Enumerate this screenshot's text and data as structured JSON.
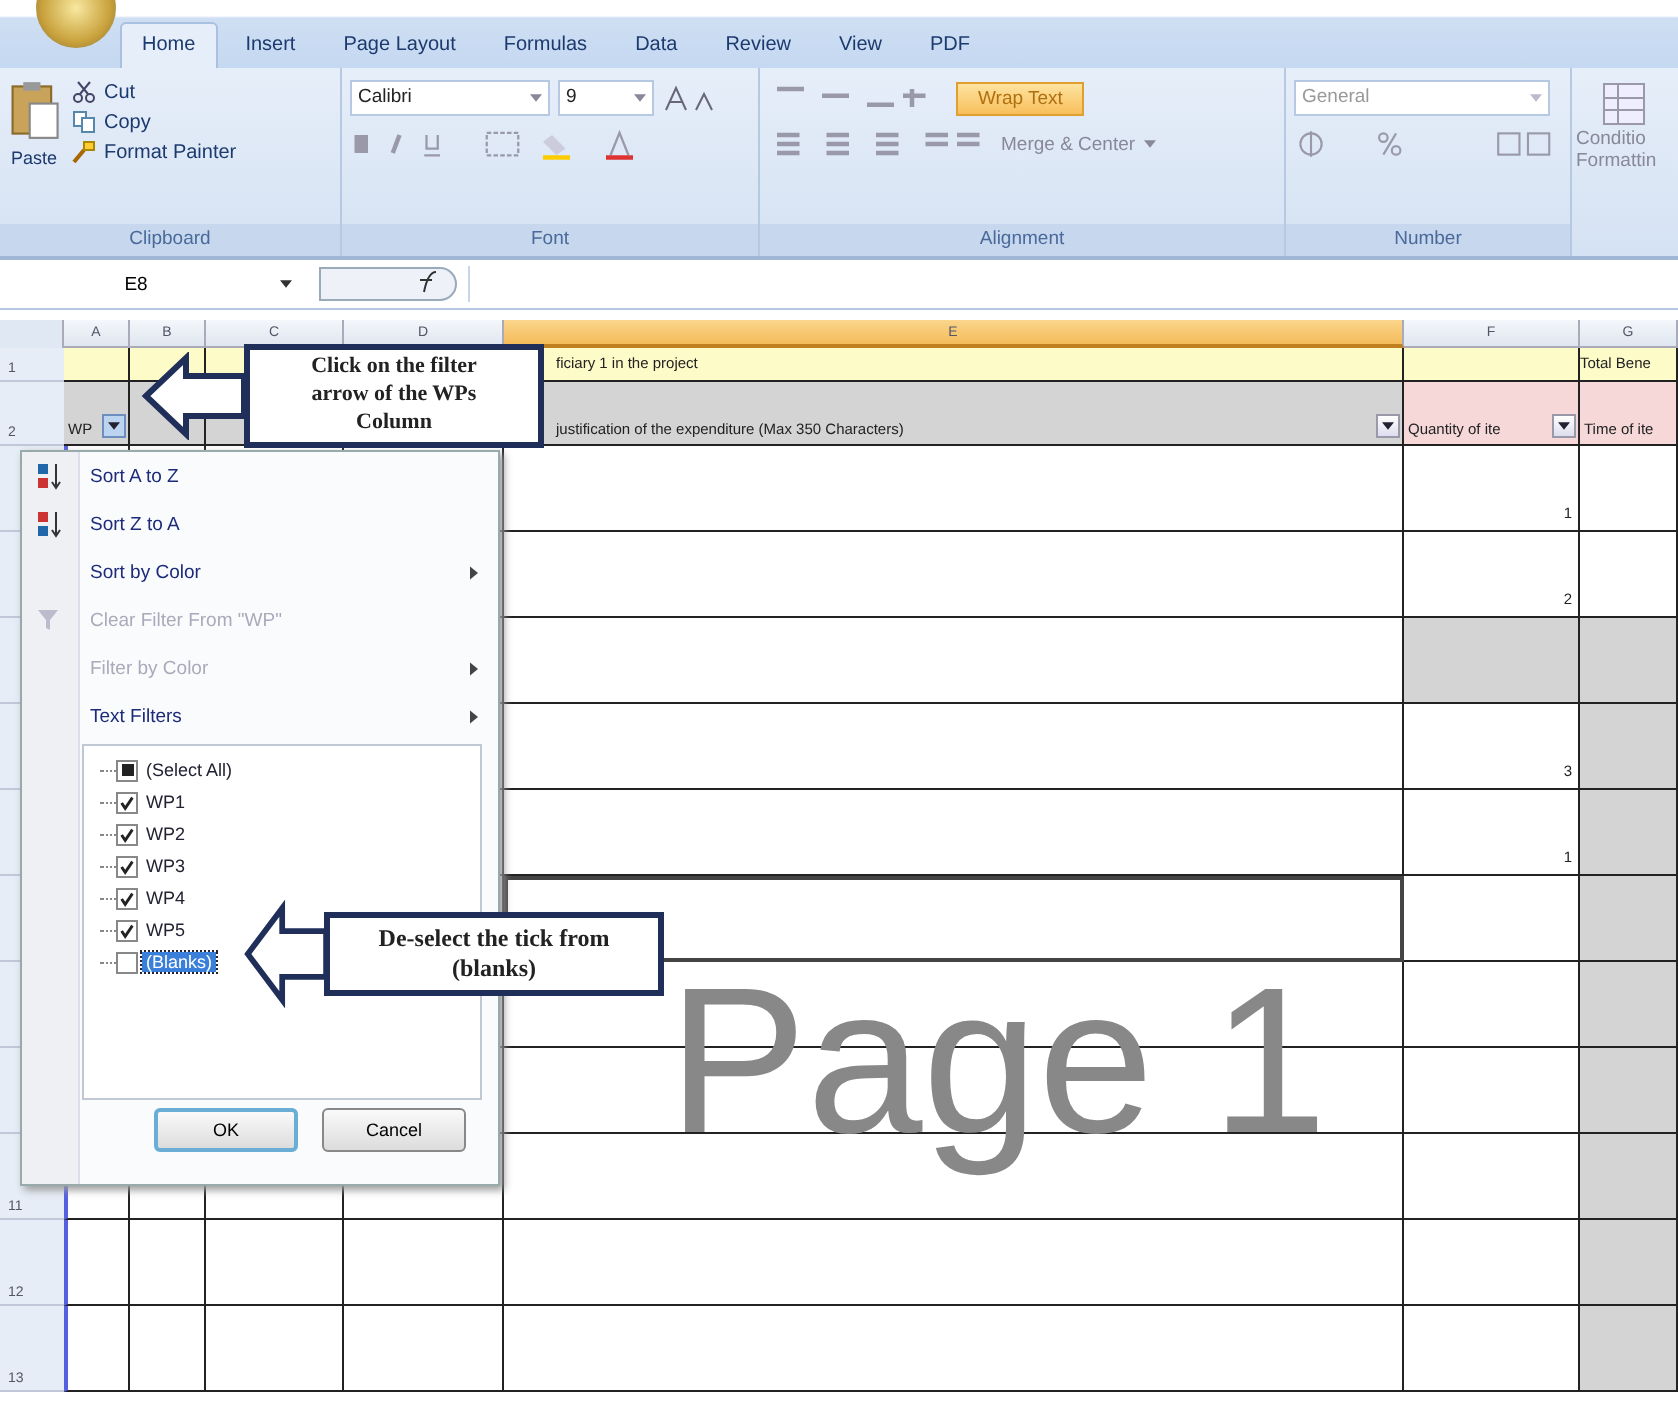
{
  "ribbon": {
    "tabs": [
      {
        "label": "Home",
        "selected": true
      },
      {
        "label": "Insert",
        "selected": false
      },
      {
        "label": "Page Layout",
        "selected": false
      },
      {
        "label": "Formulas",
        "selected": false
      },
      {
        "label": "Data",
        "selected": false
      },
      {
        "label": "Review",
        "selected": false
      },
      {
        "label": "View",
        "selected": false
      },
      {
        "label": "PDF",
        "selected": false
      }
    ],
    "clipboard": {
      "paste": "Paste",
      "cut": "Cut",
      "copy": "Copy",
      "format_painter": "Format Painter",
      "label": "Clipboard"
    },
    "font": {
      "name": "Calibri",
      "size": "9",
      "label": "Font"
    },
    "alignment": {
      "wrap_text": "Wrap Text",
      "wrap_text_on": true,
      "merge": "Merge & Center",
      "label": "Alignment"
    },
    "number": {
      "format": "General",
      "label": "Number"
    },
    "conditional": {
      "line1": "Conditio",
      "line2": "Formattin"
    }
  },
  "formula_bar": {
    "name_box": "E8"
  },
  "sheet": {
    "columns": [
      {
        "letter": "A",
        "selected": false
      },
      {
        "letter": "B",
        "selected": false
      },
      {
        "letter": "C",
        "selected": false
      },
      {
        "letter": "D",
        "selected": false
      },
      {
        "letter": "E",
        "selected": true
      },
      {
        "letter": "F",
        "selected": false
      },
      {
        "letter": "G",
        "selected": false
      }
    ],
    "row1": {
      "number": "1",
      "e": "ficiary 1 in the project",
      "g": "Total Bene"
    },
    "row2": {
      "number": "2",
      "a": "WP",
      "e": "justification of the expenditure (Max 350 Characters)",
      "f": "Quantity of ite",
      "g": "Time of ite"
    },
    "rows": [
      {
        "quantity": "1",
        "quantity_shaded": false,
        "time_shaded": false,
        "active": false
      },
      {
        "quantity": "2",
        "quantity_shaded": false,
        "time_shaded": false,
        "active": false
      },
      {
        "quantity_shaded": true,
        "time_shaded": true,
        "active": false
      },
      {
        "quantity": "3",
        "quantity_shaded": false,
        "time_shaded": true,
        "active": false
      },
      {
        "quantity": "1",
        "quantity_shaded": false,
        "time_shaded": true,
        "active": false
      },
      {
        "quantity_shaded": false,
        "time_shaded": true,
        "active": true
      },
      {
        "quantity_shaded": false,
        "time_shaded": true,
        "active": false
      },
      {
        "quantity_shaded": false,
        "time_shaded": true,
        "active": false
      },
      {
        "number": "11",
        "quantity_shaded": false,
        "time_shaded": true,
        "active": false
      },
      {
        "number": "12",
        "quantity_shaded": false,
        "time_shaded": true,
        "active": false
      },
      {
        "number": "13",
        "quantity_shaded": false,
        "time_shaded": true,
        "active": false
      }
    ],
    "watermark": "Page 1"
  },
  "filter_menu": {
    "items": [
      {
        "label": "Sort A to Z",
        "kind": "sort-asc",
        "disabled": false,
        "submenu": false
      },
      {
        "label": "Sort Z to A",
        "kind": "sort-desc",
        "disabled": false,
        "submenu": false
      },
      {
        "label": "Sort by Color",
        "kind": "plain",
        "disabled": false,
        "submenu": true
      },
      {
        "label": "Clear Filter From \"WP\"",
        "kind": "clear",
        "disabled": true,
        "submenu": false
      },
      {
        "label": "Filter by Color",
        "kind": "plain",
        "disabled": true,
        "submenu": true
      },
      {
        "label": "Text Filters",
        "kind": "plain",
        "disabled": false,
        "submenu": true
      }
    ],
    "select_all": {
      "label": "(Select All)",
      "partial": true
    },
    "values": [
      {
        "label": "WP1",
        "checked": true,
        "selected": false
      },
      {
        "label": "WP2",
        "checked": true,
        "selected": false
      },
      {
        "label": "WP3",
        "checked": true,
        "selected": false
      },
      {
        "label": "WP4",
        "checked": true,
        "selected": false
      },
      {
        "label": "WP5",
        "checked": true,
        "selected": false
      },
      {
        "label": "(Blanks)",
        "checked": false,
        "selected": true
      }
    ],
    "ok": "OK",
    "cancel": "Cancel"
  },
  "callouts": [
    {
      "text": "Click on the filter arrow  of the WPs  Column"
    },
    {
      "text": "De-select the tick from (blanks)"
    }
  ]
}
